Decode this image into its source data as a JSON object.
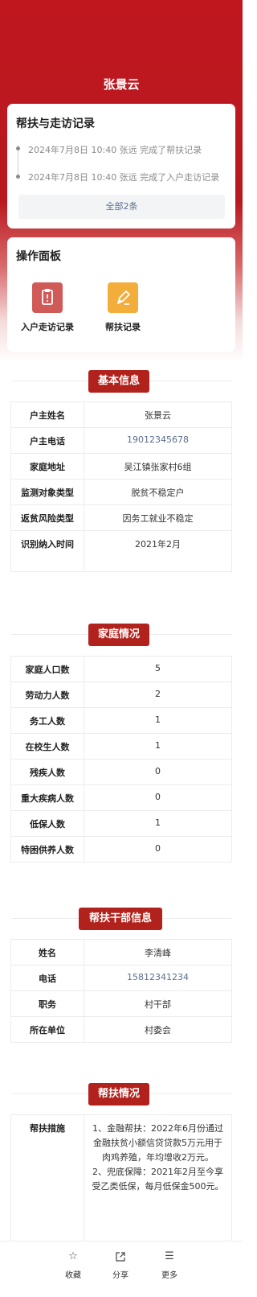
{
  "header": {
    "name": "张景云"
  },
  "records_card": {
    "title": "帮扶与走访记录",
    "records": [
      {
        "text": "2024年7月8日 10:40  张远  完成了帮扶记录"
      },
      {
        "text": "2024年7月8日 10:40  张远  完成了入户走访记录"
      }
    ],
    "all_button": "全部2条"
  },
  "operations_card": {
    "title": "操作面板",
    "items": [
      {
        "label": "入户走访记录",
        "icon": "clipboard-icon",
        "color": "#cf5a58"
      },
      {
        "label": "帮扶记录",
        "icon": "pen-icon",
        "color": "#f2ad3a"
      }
    ]
  },
  "basic_info": {
    "title": "基本信息",
    "rows": [
      {
        "key": "户主姓名",
        "value": "张景云"
      },
      {
        "key": "户主电话",
        "value": "19012345678"
      },
      {
        "key": "家庭地址",
        "value": "吴江镇张家村6组"
      },
      {
        "key": "监测对象类型",
        "value": "脱贫不稳定户"
      },
      {
        "key": "返贫风险类型",
        "value": "因务工就业不稳定"
      },
      {
        "key": "识别纳入时间",
        "value": "2021年2月"
      }
    ]
  },
  "family": {
    "title": "家庭情况",
    "rows": [
      {
        "key": "家庭人口数",
        "value": "5"
      },
      {
        "key": "劳动力人数",
        "value": "2"
      },
      {
        "key": "务工人数",
        "value": "1"
      },
      {
        "key": "在校生人数",
        "value": "1"
      },
      {
        "key": "残疾人数",
        "value": "0"
      },
      {
        "key": "重大疾病人数",
        "value": "0"
      },
      {
        "key": "低保人数",
        "value": "1"
      },
      {
        "key": "特困供养人数",
        "value": "0"
      }
    ]
  },
  "cadre": {
    "title": "帮扶干部信息",
    "rows": [
      {
        "key": "姓名",
        "value": "李清峰"
      },
      {
        "key": "电话",
        "value": "15812341234"
      },
      {
        "key": "职务",
        "value": "村干部"
      },
      {
        "key": "所在单位",
        "value": "村委会"
      }
    ]
  },
  "assistance": {
    "title": "帮扶情况",
    "key": "帮扶措施",
    "value1": "1、金融帮扶：2022年6月份通过金融扶贫小额信贷贷款5万元用于肉鸡养殖，年均增收2万元。",
    "value2": "2、兜底保障：2021年2月至今享受乙类低保，每月低保金500元。"
  },
  "bottom_bar": {
    "items": [
      {
        "label": "收藏",
        "icon": "star-icon"
      },
      {
        "label": "分享",
        "icon": "share-icon"
      },
      {
        "label": "更多",
        "icon": "menu-icon"
      }
    ]
  },
  "colors": {
    "brand_red": "#b2221c",
    "hero_red": "#c0171f",
    "link_blue": "#5a6f8e"
  }
}
